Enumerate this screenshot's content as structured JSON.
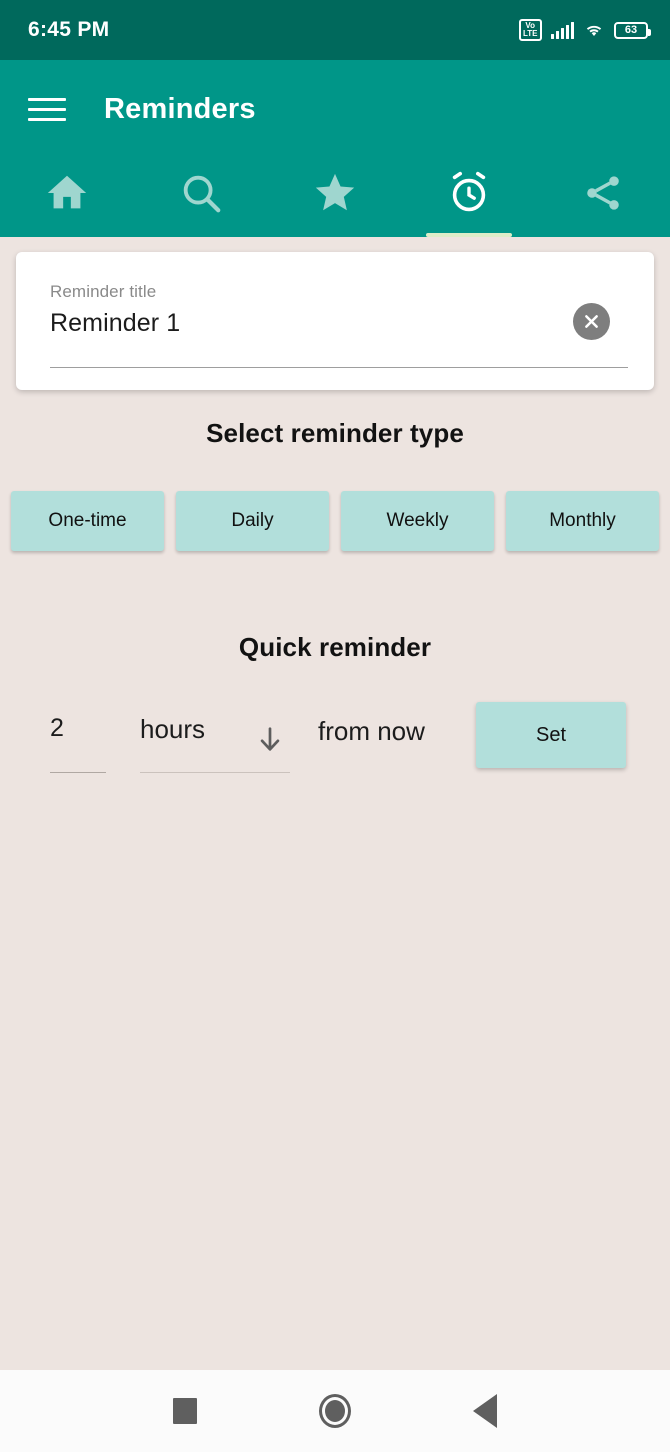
{
  "status_bar": {
    "time": "6:45 PM",
    "volte_line1": "Vo",
    "volte_line2": "LTE",
    "battery_level": "63",
    "icons": [
      "volte-icon",
      "signal-icon",
      "wifi-icon",
      "battery-icon"
    ],
    "background_color": "#00695C"
  },
  "app_bar": {
    "menu_icon": "hamburger-menu-icon",
    "title": "Reminders",
    "background_color": "#009688"
  },
  "tabs": [
    {
      "name": "home",
      "icon": "home-icon",
      "active": false
    },
    {
      "name": "search",
      "icon": "search-icon",
      "active": false
    },
    {
      "name": "favorites",
      "icon": "star-icon",
      "active": false
    },
    {
      "name": "reminders",
      "icon": "alarm-clock-icon",
      "active": true
    },
    {
      "name": "share",
      "icon": "share-icon",
      "active": false
    }
  ],
  "reminder_card": {
    "field_label": "Reminder title",
    "field_value": "Reminder 1",
    "field_placeholder": "Reminder title",
    "clear_icon": "close-circle-icon"
  },
  "type_section": {
    "title": "Select reminder type",
    "options": [
      {
        "label": "One-time"
      },
      {
        "label": "Daily"
      },
      {
        "label": "Weekly"
      },
      {
        "label": "Monthly"
      }
    ],
    "button_color": "#B2DFDB"
  },
  "quick_section": {
    "title": "Quick reminder",
    "quantity": "2",
    "unit": "hours",
    "unit_dropdown_icon": "arrow-down-icon",
    "suffix": "from now",
    "set_label": "Set"
  },
  "nav_bar": {
    "recents_icon": "square-recents-icon",
    "home_icon": "circle-home-icon",
    "back_icon": "triangle-back-icon"
  },
  "theme": {
    "background": "#EDE4E0",
    "primary": "#009688",
    "primary_dark": "#00695C",
    "accent": "#B2DFDB",
    "tab_indicator": "#DCEDC8"
  }
}
